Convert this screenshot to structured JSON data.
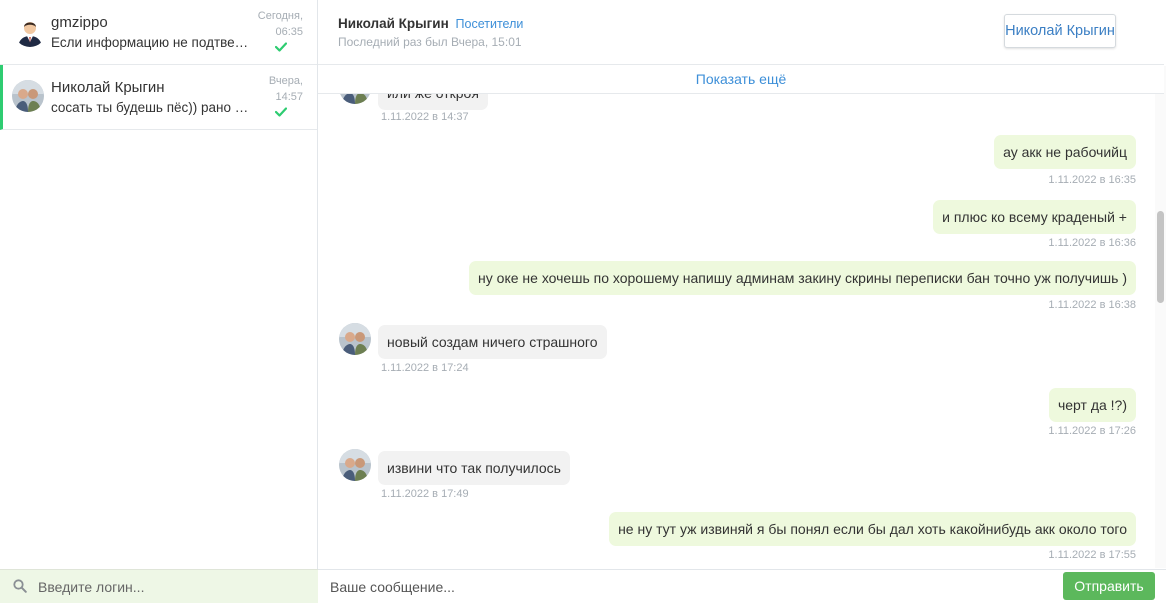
{
  "dialogs": [
    {
      "name": "gmzippo",
      "preview": "Если информацию не подтвердят",
      "time_day": "Сегодня,",
      "time_clock": "06:35"
    },
    {
      "name": "Николай Крыгин",
      "preview": "сосать ты будешь пёс)) рано или поздно",
      "time_day": "Вчера,",
      "time_clock": "14:57"
    }
  ],
  "login_search": {
    "placeholder": "Введите логин..."
  },
  "chat": {
    "contact_name": "Николай Крыгин",
    "contact_tag": "Посетители",
    "last_seen": "Последний раз был Вчера, 15:01",
    "profile_button": "Николай Крыгин",
    "show_more": "Показать ещё"
  },
  "messages": [
    {
      "direction": "in",
      "text": "или же откроя",
      "time": "1.11.2022 в 14:37"
    },
    {
      "direction": "out",
      "text": "ау акк не рабочийц",
      "time": "1.11.2022 в 16:35"
    },
    {
      "direction": "out",
      "text": "и плюс ко всему  краденый +",
      "time": "1.11.2022 в 16:36"
    },
    {
      "direction": "out",
      "text": "ну оке не хочешь по хорошему напишу админам закину скрины переписки бан точно уж получишь )",
      "time": "1.11.2022 в 16:38"
    },
    {
      "direction": "in",
      "text": "новый создам ничего страшного",
      "time": "1.11.2022 в 17:24"
    },
    {
      "direction": "out",
      "text": "черт да !?)",
      "time": "1.11.2022 в 17:26"
    },
    {
      "direction": "in",
      "text": "извини что так получилось",
      "time": "1.11.2022 в 17:49"
    },
    {
      "direction": "out",
      "text": "не ну тут уж извиняй  я бы понял если бы дал хоть какойнибудь акк около того",
      "time": "1.11.2022 в 17:55"
    }
  ],
  "composer": {
    "placeholder": "Ваше сообщение...",
    "send_label": "Отправить"
  },
  "colors": {
    "accent_green": "#2ecc71",
    "send_button": "#5cb85c",
    "link_blue": "#3d8fd8",
    "outgoing_bubble": "#eef9dd",
    "incoming_bubble": "#f2f2f2",
    "login_search_bg": "#eef7e6"
  },
  "icons": {
    "delivered": "check-icon",
    "search": "search-icon"
  }
}
